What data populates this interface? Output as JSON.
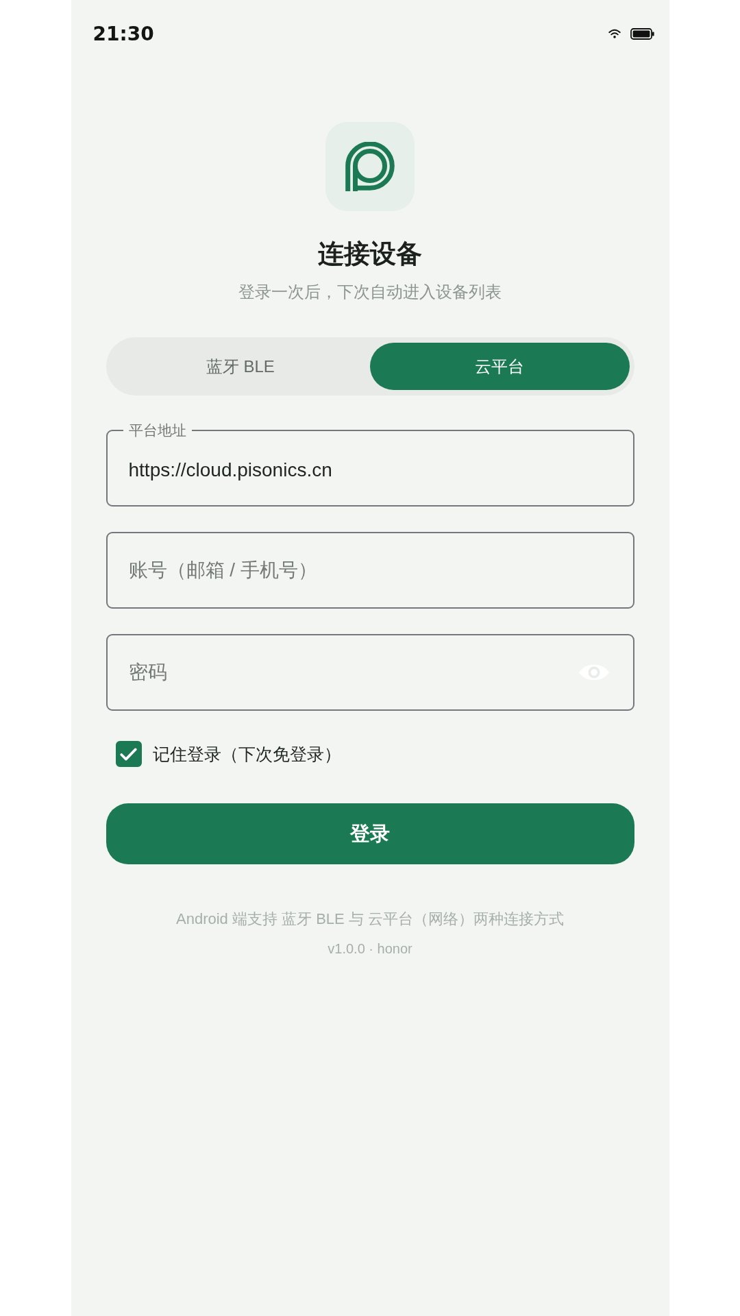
{
  "status_bar": {
    "time": "21:30"
  },
  "header": {
    "title": "连接设备",
    "subtitle": "登录一次后，下次自动进入设备列表"
  },
  "mode_tabs": [
    {
      "label": "蓝牙 BLE",
      "selected": false
    },
    {
      "label": "云平台",
      "selected": true
    }
  ],
  "fields": [
    {
      "kind": "text",
      "label": "平台地址",
      "value": "https://cloud.pisonics.cn"
    },
    {
      "kind": "text",
      "placeholder": "账号（邮箱 / 手机号）"
    },
    {
      "kind": "password",
      "placeholder": "密码"
    }
  ],
  "remember": {
    "label": "记住登录（下次免登录）",
    "checked": true
  },
  "login_button": {
    "label": "登录"
  },
  "footer": {
    "note": "Android 端支持 蓝牙 BLE 与 云平台（网络）两种连接方式",
    "version": "v1.0.0 · honor"
  }
}
